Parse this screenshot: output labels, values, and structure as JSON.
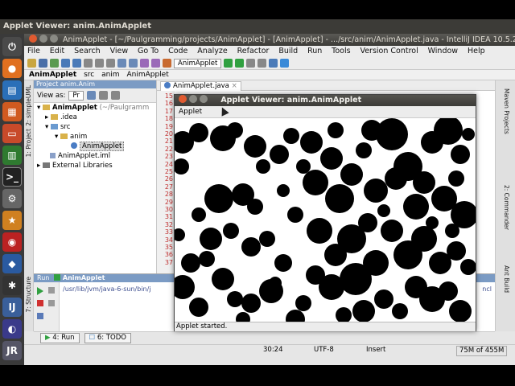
{
  "top_panel": {
    "title": "Applet Viewer: anim.AnimApplet"
  },
  "launcher": {
    "icons": [
      "power-icon",
      "firefox-icon",
      "writer-icon",
      "impress-icon",
      "calc-icon",
      "files-icon",
      "terminal-icon",
      "settings-icon",
      "store-icon",
      "ubuntu-one-icon",
      "virtualbox-icon",
      "spider-icon",
      "intellij-icon",
      "eclipse-icon",
      "jr-icon"
    ]
  },
  "ide": {
    "window_title": "AnimApplet - [~/Paulgramming/projects/AnimApplet] - [AnimApplet] - .../src/anim/AnimApplet.java - IntelliJ IDEA 10.5.2",
    "menu": [
      "File",
      "Edit",
      "Search",
      "View",
      "Go To",
      "Code",
      "Analyze",
      "Refactor",
      "Build",
      "Run",
      "Tools",
      "Version Control",
      "Window",
      "Help"
    ],
    "run_config": "AnimApplet",
    "nav": [
      "AnimApplet",
      "src",
      "anim",
      "AnimApplet"
    ],
    "left_tabs": [
      "1: Project",
      "2: simpleUML"
    ],
    "right_tabs": [
      "Maven Projects",
      "2: Commander",
      "Ant Build"
    ],
    "project_panel": {
      "header": "Project anim.Anim",
      "view_label": "View as:",
      "view_value": "Pr",
      "tree": [
        {
          "label": "AnimApplet",
          "suffix": "(~/Paulgramm",
          "indent": 0,
          "type": "folder"
        },
        {
          "label": ".idea",
          "indent": 1,
          "type": "folder"
        },
        {
          "label": "src",
          "indent": 1,
          "type": "folder"
        },
        {
          "label": "anim",
          "indent": 2,
          "type": "folder"
        },
        {
          "label": "AnimApplet",
          "indent": 3,
          "type": "class",
          "selected": true
        },
        {
          "label": "AnimApplet.iml",
          "indent": 1,
          "type": "file"
        },
        {
          "label": "External Libraries",
          "indent": 0,
          "type": "lib"
        }
      ]
    },
    "editor": {
      "tab": "AnimApplet.java",
      "line_numbers": [
        "15",
        "16",
        "17",
        "18",
        "19",
        "20",
        "21",
        "22",
        "23",
        "24",
        "25",
        "26",
        "27",
        "28",
        "29",
        "30",
        "31",
        "32",
        "33",
        "34",
        "35",
        "36",
        "37"
      ]
    },
    "run_panel": {
      "header": "Run",
      "header_item": "AnimApplet",
      "output": "/usr/lib/jvm/java-6-sun/bin/j",
      "output_right": "ncl",
      "structure_tab": "7: Structure"
    },
    "bottom_tabs": [
      "4: Run",
      "6: TODO"
    ],
    "status": {
      "position": "30:24",
      "encoding": "UTF-8",
      "mode": "Insert",
      "memory": "75M of 455M"
    }
  },
  "applet": {
    "title": "Applet Viewer: anim.AnimApplet",
    "menu": "Applet",
    "status": "Applet started.",
    "colors": {
      "background": "#ffffff",
      "circle": "#000000"
    }
  }
}
